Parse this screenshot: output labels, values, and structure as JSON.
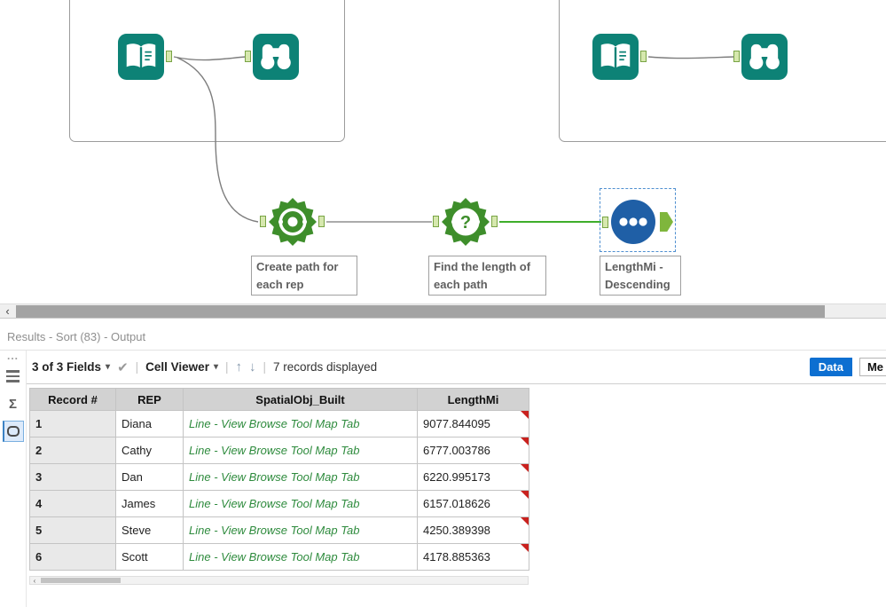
{
  "colors": {
    "teal": "#0d8276",
    "tool_green": "#3e8e2b",
    "sort_blue": "#1f5fa6",
    "link_green": "#2e8b3d",
    "tab_blue": "#0d6fd1",
    "flag_red": "#c9211e",
    "wire_green": "#3fae2a",
    "wire_gray": "#7d7d7d"
  },
  "canvas": {
    "tool_labels": [
      {
        "label": "Create path for each rep"
      },
      {
        "label": "Find the length of each path"
      },
      {
        "label": "LengthMi - Descending"
      }
    ]
  },
  "results": {
    "title": "Results - Sort (83) - Output",
    "toolbar": {
      "fields": "3 of 3 Fields",
      "cell_viewer": "Cell Viewer",
      "records": "7 records displayed",
      "data_tab": "Data",
      "metadata_tab": "Me"
    },
    "table": {
      "headers": [
        "Record #",
        "REP",
        "SpatialObj_Built",
        "LengthMi"
      ],
      "rows": [
        {
          "record": "1",
          "rep": "Diana",
          "spatial": "Line - View Browse Tool Map Tab",
          "length": "9077.844095"
        },
        {
          "record": "2",
          "rep": "Cathy",
          "spatial": "Line - View Browse Tool Map Tab",
          "length": "6777.003786"
        },
        {
          "record": "3",
          "rep": "Dan",
          "spatial": "Line - View Browse Tool Map Tab",
          "length": "6220.995173"
        },
        {
          "record": "4",
          "rep": "James",
          "spatial": "Line - View Browse Tool Map Tab",
          "length": "6157.018626"
        },
        {
          "record": "5",
          "rep": "Steve",
          "spatial": "Line - View Browse Tool Map Tab",
          "length": "4250.389398"
        },
        {
          "record": "6",
          "rep": "Scott",
          "spatial": "Line - View Browse Tool Map Tab",
          "length": "4178.885363"
        }
      ]
    }
  }
}
